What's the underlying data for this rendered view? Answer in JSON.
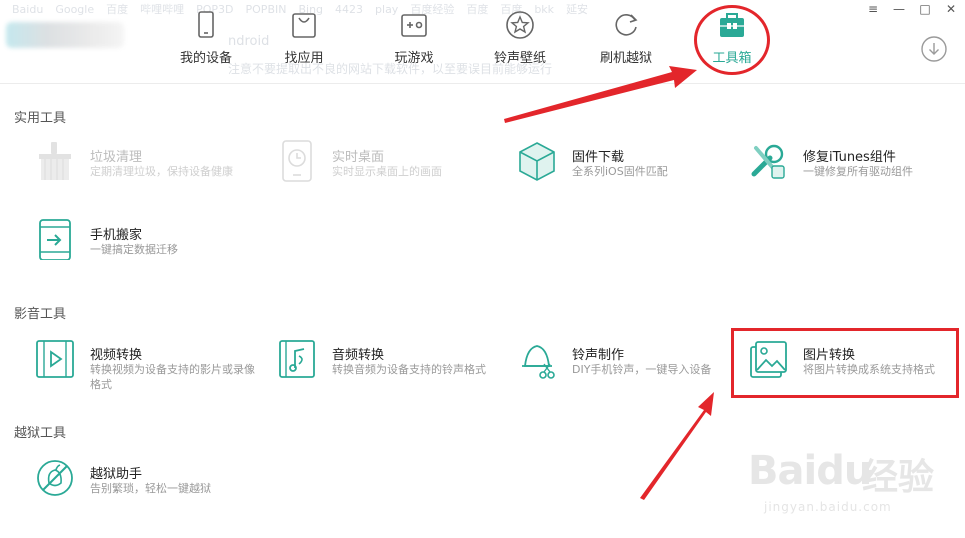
{
  "background": {
    "ghost_tabs": [
      "Baidu",
      "Google",
      "百度",
      "哔哩哔哩",
      "POP3D",
      "POPBIN",
      "Bing",
      "4423",
      "play",
      "百度经验",
      "百度",
      "百度",
      "bkk",
      "延安"
    ],
    "ghost_title": "ndroid",
    "ghost_line": "注意不要提取出不良的网站下载软件，以至要误目前能够运行"
  },
  "window_controls": [
    "≡",
    "—",
    "□",
    "✕"
  ],
  "nav": {
    "items": [
      {
        "label": "我的设备",
        "icon": "phone-icon"
      },
      {
        "label": "找应用",
        "icon": "bag-icon"
      },
      {
        "label": "玩游戏",
        "icon": "gamepad-icon"
      },
      {
        "label": "铃声壁纸",
        "icon": "star-icon"
      },
      {
        "label": "刷机越狱",
        "icon": "refresh-icon"
      },
      {
        "label": "工具箱",
        "icon": "toolbox-icon",
        "active": true
      }
    ],
    "accent_color": "#2aa996"
  },
  "sections": [
    {
      "title": "实用工具",
      "tools": [
        {
          "name": "垃圾清理",
          "desc": "定期清理垃圾，保持设备健康",
          "icon": "broom-icon",
          "dim": true
        },
        {
          "name": "实时桌面",
          "desc": "实时显示桌面上的画面",
          "icon": "clock-phone-icon",
          "dim": true
        },
        {
          "name": "固件下载",
          "desc": "全系列iOS固件匹配",
          "icon": "cube-icon"
        },
        {
          "name": "修复iTunes组件",
          "desc": "一键修复所有驱动组件",
          "icon": "wrench-icon"
        },
        {
          "name": "手机搬家",
          "desc": "一键搞定数据迁移",
          "icon": "phone-transfer-icon"
        }
      ]
    },
    {
      "title": "影音工具",
      "tools": [
        {
          "name": "视频转换",
          "desc": "转换视频为设备支持的影片或录像格式",
          "icon": "video-icon"
        },
        {
          "name": "音频转换",
          "desc": "转换音频为设备支持的铃声格式",
          "icon": "audio-icon"
        },
        {
          "name": "铃声制作",
          "desc": "DIY手机铃声，一键导入设备",
          "icon": "bell-scissors-icon"
        },
        {
          "name": "图片转换",
          "desc": "将图片转换成系统支持格式",
          "icon": "image-convert-icon"
        }
      ]
    },
    {
      "title": "越狱工具",
      "tools": [
        {
          "name": "越狱助手",
          "desc": "告别繁琐，轻松一键越狱",
          "icon": "jailbreak-icon"
        }
      ]
    }
  ],
  "watermark": {
    "main": "Bai",
    "main2": "du",
    "cn": "经验",
    "sub": "jingyan.baidu.com"
  },
  "annotation_color": "#e3262b"
}
